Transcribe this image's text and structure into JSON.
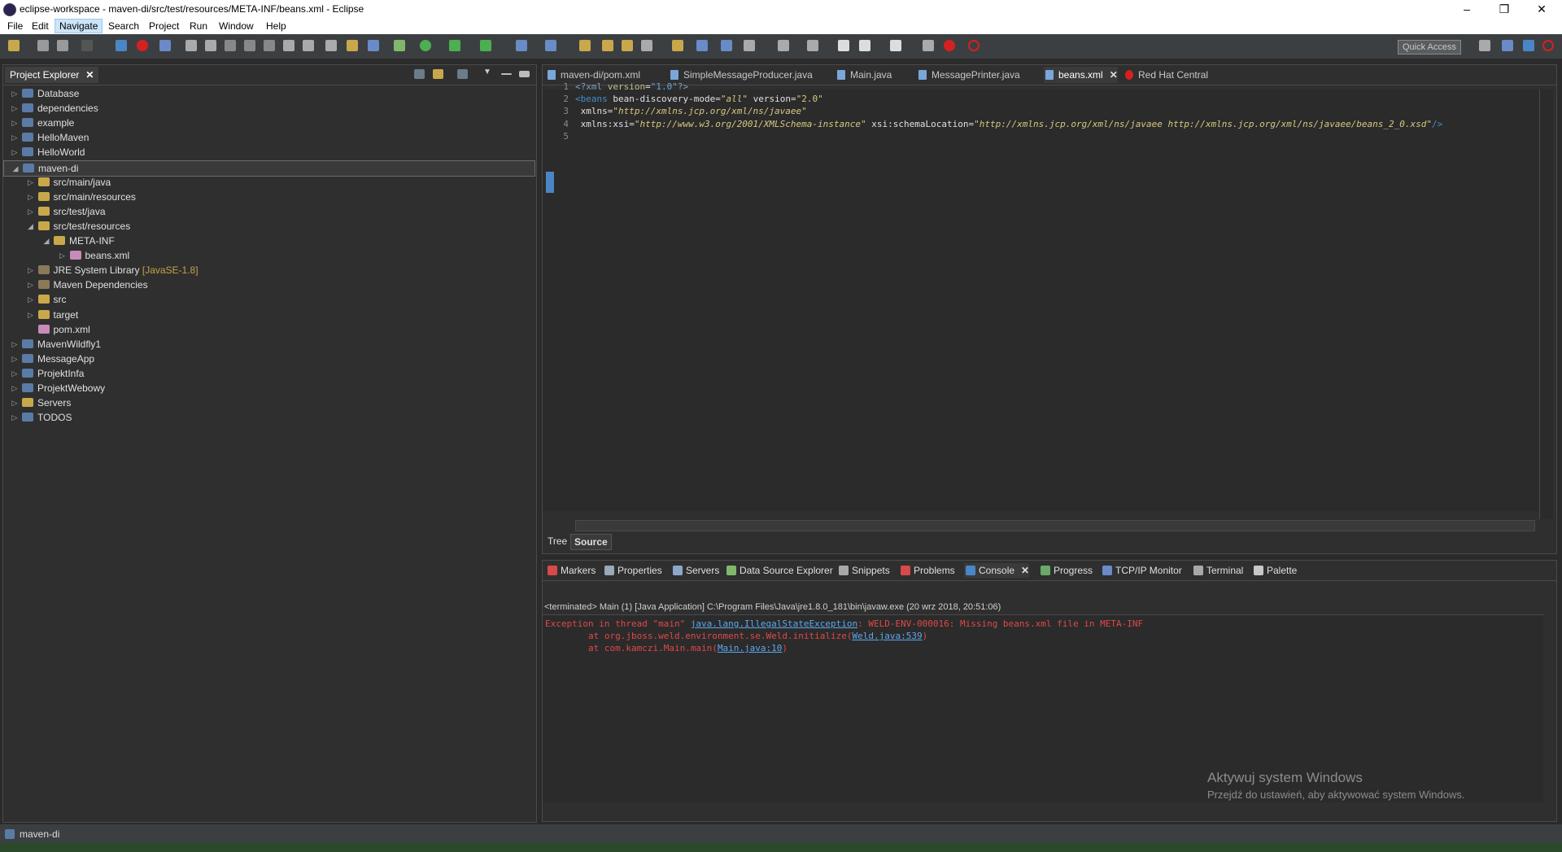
{
  "window": {
    "title": "eclipse-workspace - maven-di/src/test/resources/META-INF/beans.xml - Eclipse",
    "minimize": "–",
    "restore": "❐",
    "close": "✕"
  },
  "menu": [
    "File",
    "Edit",
    "Navigate",
    "Search",
    "Project",
    "Run",
    "Window",
    "Help"
  ],
  "toolbar": {
    "quick_access_placeholder": "Quick Access"
  },
  "project_explorer": {
    "tab_label": "Project Explorer",
    "tree": [
      {
        "label": "Database",
        "level": 0,
        "expanded": false,
        "icon": "project-icon"
      },
      {
        "label": "dependencies",
        "level": 0,
        "expanded": false,
        "icon": "project-icon"
      },
      {
        "label": "example",
        "level": 0,
        "expanded": false,
        "icon": "project-icon"
      },
      {
        "label": "HelloMaven",
        "level": 0,
        "expanded": false,
        "icon": "project-icon"
      },
      {
        "label": "HelloWorld",
        "level": 0,
        "expanded": false,
        "icon": "project-icon"
      },
      {
        "label": "maven-di",
        "level": 0,
        "expanded": true,
        "icon": "project-icon",
        "selected": true
      },
      {
        "label": "src/main/java",
        "level": 1,
        "expanded": false,
        "icon": "folder-icon"
      },
      {
        "label": "src/main/resources",
        "level": 1,
        "expanded": false,
        "icon": "folder-icon"
      },
      {
        "label": "src/test/java",
        "level": 1,
        "expanded": false,
        "icon": "folder-icon"
      },
      {
        "label": "src/test/resources",
        "level": 1,
        "expanded": true,
        "icon": "folder-icon"
      },
      {
        "label": "META-INF",
        "level": 2,
        "expanded": true,
        "icon": "folder-icon"
      },
      {
        "label": "beans.xml",
        "level": 3,
        "expanded": false,
        "icon": "xml-file-icon"
      },
      {
        "label": "JRE System Library",
        "decoration": "[JavaSE-1.8]",
        "level": 1,
        "expanded": false,
        "icon": "library-icon"
      },
      {
        "label": "Maven Dependencies",
        "level": 1,
        "expanded": false,
        "icon": "library-icon"
      },
      {
        "label": "src",
        "level": 1,
        "expanded": false,
        "icon": "folder-icon"
      },
      {
        "label": "target",
        "level": 1,
        "expanded": false,
        "icon": "folder-icon"
      },
      {
        "label": "pom.xml",
        "level": 1,
        "expanded": null,
        "icon": "xml-file-icon"
      },
      {
        "label": "MavenWildfly1",
        "level": 0,
        "expanded": false,
        "icon": "project-icon"
      },
      {
        "label": "MessageApp",
        "level": 0,
        "expanded": false,
        "icon": "project-icon"
      },
      {
        "label": "ProjektInfa",
        "level": 0,
        "expanded": false,
        "icon": "project-icon"
      },
      {
        "label": "ProjektWebowy",
        "level": 0,
        "expanded": false,
        "icon": "project-icon"
      },
      {
        "label": "Servers",
        "level": 0,
        "expanded": false,
        "icon": "folder-icon"
      },
      {
        "label": "TODOS",
        "level": 0,
        "expanded": false,
        "icon": "project-icon"
      }
    ]
  },
  "editor": {
    "tabs": [
      {
        "label": "maven-di/pom.xml",
        "active": false
      },
      {
        "label": "SimpleMessageProducer.java",
        "active": false
      },
      {
        "label": "Main.java",
        "active": false
      },
      {
        "label": "MessagePrinter.java",
        "active": false
      },
      {
        "label": "beans.xml",
        "active": true
      },
      {
        "label": "Red Hat Central",
        "active": false
      }
    ],
    "lines": [
      {
        "n": "1",
        "html": "<span style='color:#7f9fbf'>&lt;?xml</span> <span style='color:#b8c48c'>version</span>=<span style='color:#6aa5e0'>\"1.0\"</span><span style='color:#7f9fbf'>?&gt;</span>"
      },
      {
        "n": "2",
        "html": "<span style='color:#3e8fcf'>&lt;beans</span> <span style='color:#e0e0e0'>bean-discovery-mode</span>=<span style='color:#d8c87f;font-style:italic'>\"all\"</span> <span style='color:#e0e0e0'>version</span>=<span style='color:#d8c87f'>\"2.0\"</span>"
      },
      {
        "n": "3",
        "html": " <span style='color:#e0e0e0'>xmlns</span>=<span style='color:#d8c87f;font-style:italic'>\"http://xmlns.jcp.org/xml/ns/javaee\"</span>"
      },
      {
        "n": "4",
        "html": " <span style='color:#e0e0e0'>xmlns:xsi</span>=<span style='color:#d8c87f;font-style:italic'>\"http://www.w3.org/2001/XMLSchema-instance\"</span> <span style='color:#e0e0e0'>xsi:schemaLocation</span>=<span style='color:#d8c87f;font-style:italic'>\"http://xmlns.jcp.org/xml/ns/javaee http://xmlns.jcp.org/xml/ns/javaee/beans_2_0.xsd\"</span><span style='color:#3e8fcf'>/&gt;</span>"
      },
      {
        "n": "5",
        "html": ""
      }
    ],
    "bottom_tabs": [
      {
        "label": "Tree",
        "active": false
      },
      {
        "label": "Source",
        "active": true
      }
    ]
  },
  "console": {
    "tabs": [
      {
        "label": "Markers",
        "color": "#d64a4a"
      },
      {
        "label": "Properties",
        "color": "#9aa8b8"
      },
      {
        "label": "Servers",
        "color": "#8ca8c8"
      },
      {
        "label": "Data Source Explorer",
        "color": "#7fb86a"
      },
      {
        "label": "Snippets",
        "color": "#a8a8a8"
      },
      {
        "label": "Problems",
        "color": "#d64a4a"
      },
      {
        "label": "Console",
        "color": "#4a86c7",
        "active": true
      },
      {
        "label": "Progress",
        "color": "#6aa86a"
      },
      {
        "label": "TCP/IP Monitor",
        "color": "#6a8ac8"
      },
      {
        "label": "Terminal",
        "color": "#a8a8a8"
      },
      {
        "label": "Palette",
        "color": "#c8c8c8"
      }
    ],
    "info": "<terminated> Main (1) [Java Application] C:\\Program Files\\Java\\jre1.8.0_181\\bin\\javaw.exe (20 wrz 2018, 20:51:06)",
    "lines": [
      {
        "html": "Exception in thread \"main\" <span class='lnk'>java.lang.IllegalStateException</span>: WELD-ENV-000016: Missing beans.xml file in META-INF"
      },
      {
        "html": "\tat org.jboss.weld.environment.se.Weld.initialize(<span class='lnk'>Weld.java:539</span>)"
      },
      {
        "html": "\tat com.kamczi.Main.main(<span class='lnk'>Main.java:10</span>)"
      }
    ]
  },
  "watermark": {
    "title": "Aktywuj system Windows",
    "subtitle": "Przejdź do ustawień, aby aktywować system Windows."
  },
  "status_bar": {
    "text": "maven-di"
  },
  "colors": {
    "accent": "#4a86c7",
    "error": "#e04848",
    "link": "#5ba8f0"
  }
}
